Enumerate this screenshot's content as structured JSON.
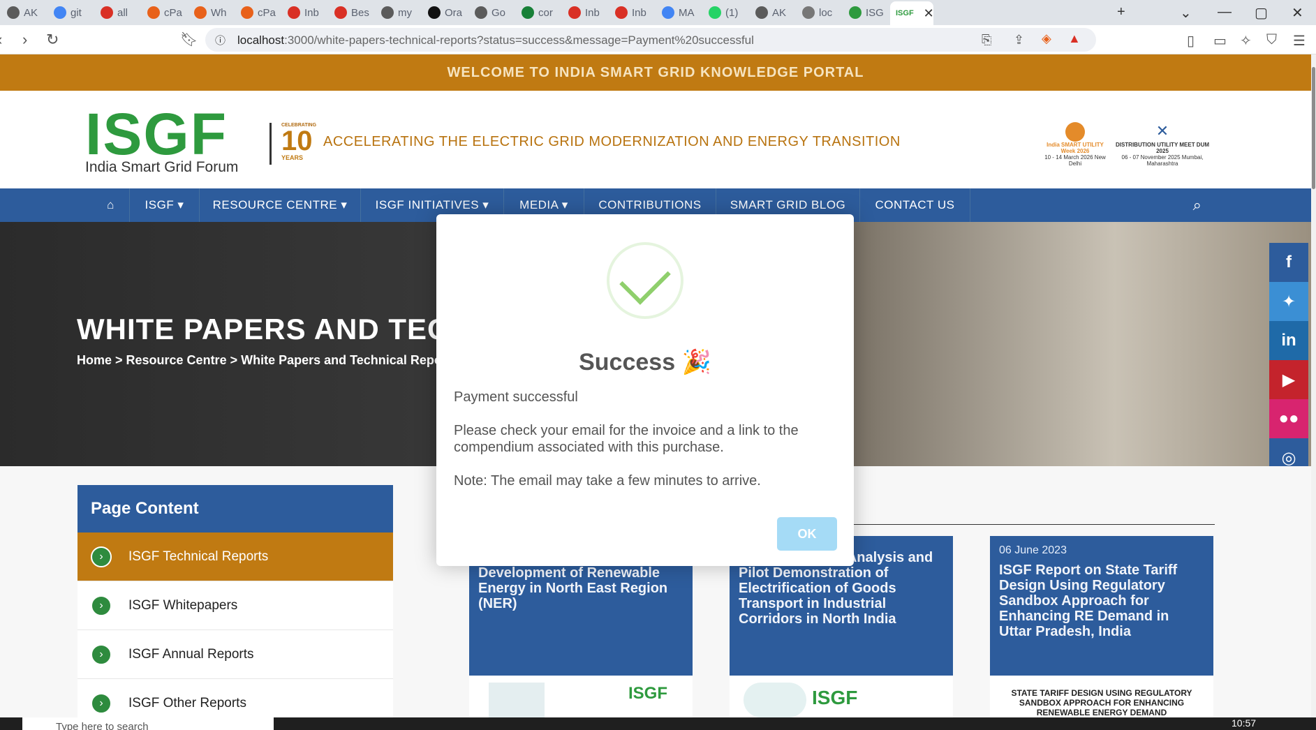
{
  "browser": {
    "tabs": [
      {
        "label": "AK",
        "color": "#5b5b5b"
      },
      {
        "label": "git",
        "color": "#4285f4"
      },
      {
        "label": "all",
        "color": "#d93025"
      },
      {
        "label": "cPa",
        "color": "#e8611a"
      },
      {
        "label": "Wh",
        "color": "#e8611a"
      },
      {
        "label": "cPa",
        "color": "#e8611a"
      },
      {
        "label": "Inb",
        "color": "#d93025"
      },
      {
        "label": "Bes",
        "color": "#d93025"
      },
      {
        "label": "my",
        "color": "#5b5b5b"
      },
      {
        "label": "Ora",
        "color": "#111111"
      },
      {
        "label": "Go",
        "color": "#5b5b5b"
      },
      {
        "label": "cor",
        "color": "#188038"
      },
      {
        "label": "Inb",
        "color": "#d93025"
      },
      {
        "label": "Inb",
        "color": "#d93025"
      },
      {
        "label": "MA",
        "color": "#4285f4"
      },
      {
        "label": "(1)",
        "color": "#25d366"
      },
      {
        "label": "AK",
        "color": "#5b5b5b"
      },
      {
        "label": "loc",
        "color": "#777777"
      },
      {
        "label": "ISG",
        "color": "#2e9a3e"
      }
    ],
    "active_tab_favicon": "ISGF",
    "url_host": "localhost",
    "url_rest": ":3000/white-papers-technical-reports?status=success&message=Payment%20successful"
  },
  "site": {
    "welcome": "WELCOME TO INDIA SMART GRID KNOWLEDGE PORTAL",
    "logo": "ISGF",
    "logo_sub": "India Smart Grid Forum",
    "celebrating": "CELEBRATING",
    "ten": "10",
    "years": "YEARS",
    "tagline": "ACCELERATING THE ELECTRIC GRID MODERNIZATION AND ENERGY TRANSITION",
    "event1": "India SMART UTILITY Week 2026",
    "event1_date": "10 - 14 March 2026 New Delhi",
    "event2": "DISTRIBUTION UTILITY MEET DUM 2025",
    "event2_date": "06 - 07 November 2025 Mumbai, Maharashtra",
    "nav": [
      "ISGF",
      "RESOURCE CENTRE",
      "ISGF INITIATIVES",
      "MEDIA",
      "CONTRIBUTIONS",
      "SMART GRID BLOG",
      "CONTACT US"
    ],
    "hero_title": "WHITE PAPERS AND TECHNICAL REPORTS",
    "breadcrumb": "Home > Resource Centre > White Papers and Technical Reports",
    "sidebar_title": "Page Content",
    "sidebar_items": [
      "ISGF Technical Reports",
      "ISGF Whitepapers",
      "ISGF Annual Reports",
      "ISGF Other Reports"
    ],
    "cards": [
      {
        "date": "",
        "title": "Study Report on Accelerated Development of Renewable Energy in North East Region (NER)"
      },
      {
        "date": "",
        "title": "Final Feasibility Analysis and Pilot Demonstration of Electrification of Goods Transport in Industrial Corridors in North India"
      },
      {
        "date": "06 June 2023",
        "title": "ISGF Report on State Tariff Design Using Regulatory Sandbox Approach for Enhancing RE Demand in Uttar Pradesh, India"
      }
    ],
    "card3_image_text": "STATE TARIFF DESIGN USING REGULATORY SANDBOX APPROACH FOR ENHANCING RENEWABLE ENERGY DEMAND"
  },
  "modal": {
    "title": "Success 🎉",
    "line1": "Payment successful",
    "line2": "Please check your email for the invoice and a link to the compendium associated with this purchase.",
    "line3": "Note: The email may take a few minutes to arrive.",
    "ok": "OK"
  },
  "taskbar": {
    "search_placeholder": "Type here to search",
    "time": "10:57"
  }
}
